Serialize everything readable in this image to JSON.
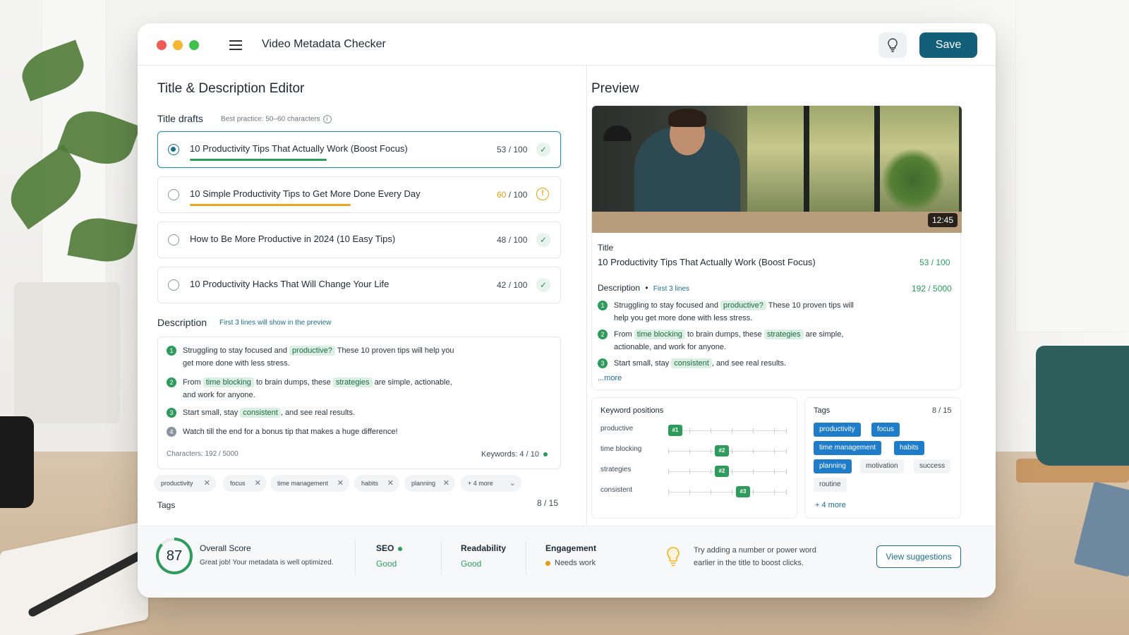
{
  "app": {
    "title": "Video Metadata Checker",
    "save_label": "Save"
  },
  "editor": {
    "heading": "Title & Description Editor",
    "title_drafts": {
      "label": "Title drafts",
      "hint": "Best practice: 50–60 characters",
      "drafts": [
        {
          "text": "10 Productivity Tips That Actually Work (Boost Focus)",
          "count": "53",
          "max": "/ 100",
          "status": "ok",
          "selected": true,
          "bar_color": "#2e9a5c",
          "bar_fraction": 0.53
        },
        {
          "text": "10 Simple Productivity Tips to Get More Done Every Day",
          "count": "60",
          "max": "/ 100",
          "status": "warn",
          "selected": false,
          "bar_color": "#f0a21a",
          "bar_fraction": 0.6
        },
        {
          "text": "How to Be More Productive in 2024 (10 Easy Tips)",
          "count": "48",
          "max": "/ 100",
          "status": "ok",
          "selected": false
        },
        {
          "text": "10 Productivity Hacks That Will Change Your Life",
          "count": "42",
          "max": "/ 100",
          "status": "ok",
          "selected": false
        }
      ]
    },
    "description": {
      "label": "Description",
      "hint": "First 3 lines will show in the preview",
      "lines": [
        {
          "n": "1",
          "pre": "Struggling to stay focused and ",
          "kw": "productive?",
          "post": " These 10 proven tips will help you get more done with less stress."
        },
        {
          "n": "2",
          "pre": "From ",
          "kw": "time blocking",
          "mid": " to brain dumps, these ",
          "kw2": "strategies",
          "post": " are simple, actionable, and work for anyone."
        },
        {
          "n": "3",
          "pre": "Start small, stay ",
          "kw": "consistent",
          "post": ", and see real results."
        },
        {
          "n": "4",
          "pre": "Watch till the end for a bonus tip that makes a huge difference!"
        }
      ],
      "characters": "Characters: 192 / 5000",
      "keywords": "Keywords:  4 / 10"
    },
    "tags": {
      "label": "Tags",
      "items": [
        "productivity",
        "focus",
        "time management",
        "habits",
        "planning"
      ],
      "more": "+ 4 more",
      "count": "8 / 15"
    }
  },
  "preview": {
    "heading": "Preview",
    "duration": "12:45",
    "title_label": "Title",
    "title_text": "10 Productivity Tips That Actually Work (Boost Focus)",
    "title_count": "53 / 100",
    "desc_label": "Description",
    "desc_bullet": "•",
    "desc_hint": "First 3 lines",
    "desc_count": "192 / 5000",
    "desc_lines": [
      {
        "n": "1",
        "pre": "Struggling to stay focused and ",
        "kw": "productive?",
        "post": " These 10 proven tips will help you get more done with less stress."
      },
      {
        "n": "2",
        "pre": "From ",
        "kw": "time blocking",
        "mid": " to brain dumps, these ",
        "kw2": "strategies",
        "post": " are simple, actionable, and work for anyone."
      },
      {
        "n": "3",
        "pre": "Start small, stay ",
        "kw": "consistent",
        "post": ", and see real results."
      }
    ],
    "more_link": "...more",
    "keyword_positions": {
      "label": "Keyword positions",
      "rows": [
        {
          "name": "productive",
          "rank": "#1",
          "position_fraction": 0.0
        },
        {
          "name": "time blocking",
          "rank": "#2",
          "position_fraction": 0.45
        },
        {
          "name": "strategies",
          "rank": "#2",
          "position_fraction": 0.45
        },
        {
          "name": "consistent",
          "rank": "#3",
          "position_fraction": 0.65
        }
      ]
    },
    "tags": {
      "label": "Tags",
      "count": "8 / 15",
      "items": [
        {
          "text": "productivity",
          "style": "blue"
        },
        {
          "text": "focus",
          "style": "blue"
        },
        {
          "text": "time management",
          "style": "blue"
        },
        {
          "text": "habits",
          "style": "blue"
        },
        {
          "text": "planning",
          "style": "blue"
        },
        {
          "text": "motivation",
          "style": "gray"
        },
        {
          "text": "success",
          "style": "gray"
        },
        {
          "text": "routine",
          "style": "gray"
        }
      ],
      "more": "+ 4 more"
    }
  },
  "summary": {
    "score": "87",
    "score_fraction": 0.87,
    "score_label": "Overall Score",
    "score_msg": "Great job! Your metadata is well optimized.",
    "seo_label": "SEO",
    "seo_value": "Good",
    "readability_label": "Readability",
    "readability_value": "Good",
    "engagement_label": "Engagement",
    "engagement_value": "Needs work",
    "tip_line1": "Try adding a number or power word",
    "tip_line2": "earlier in the title to boost clicks.",
    "view_btn": "View suggestions"
  },
  "colors": {
    "accent": "#135e79",
    "good": "#2e9a5c",
    "warn": "#e69b16",
    "tag_blue": "#1f7cc9"
  }
}
